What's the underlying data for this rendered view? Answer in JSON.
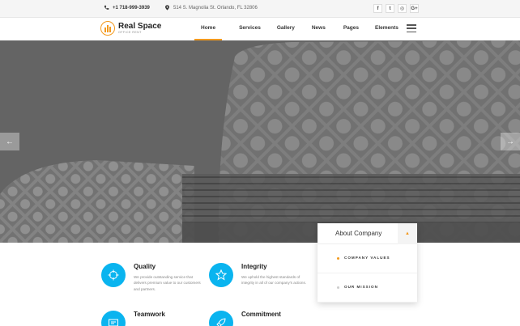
{
  "topbar": {
    "phone": "+1 718-999-3939",
    "address": "514 S. Magnolia St. Orlando, FL 32806",
    "socials": [
      {
        "icon": "facebook-icon",
        "glyph": "f"
      },
      {
        "icon": "twitter-icon",
        "glyph": "t"
      },
      {
        "icon": "instagram-icon",
        "glyph": "◎"
      },
      {
        "icon": "google-plus-icon",
        "glyph": "G+"
      }
    ]
  },
  "header": {
    "brand": "Real Space",
    "tagline": "OFFICE RENT",
    "nav": [
      "Home",
      "Services",
      "Gallery",
      "News",
      "Pages",
      "Elements"
    ],
    "active_nav": "Home",
    "accent": "#f39a1e"
  },
  "hero": {
    "prev_glyph": "←",
    "next_glyph": "→"
  },
  "features": [
    {
      "title": "Quality",
      "desc": "We provide outstanding service that delivers premium value to our customers and partners.",
      "icon": "target-icon"
    },
    {
      "title": "Integrity",
      "desc": "We uphold the highest standards of integrity in all of our company's actions.",
      "icon": "star-icon"
    },
    {
      "title": "Teamwork",
      "desc": "",
      "icon": "id-card-icon"
    },
    {
      "title": "Commitment",
      "desc": "",
      "icon": "rocket-icon"
    }
  ],
  "feature_color": "#0ab4ef",
  "accordion": {
    "title": "About Company",
    "toggle_glyph": "▲",
    "items": [
      {
        "label": "COMPANY VALUES",
        "bullet_color": "#f39a1e"
      },
      {
        "label": "OUR MISSION",
        "bullet_color": "#cccccc"
      }
    ]
  }
}
